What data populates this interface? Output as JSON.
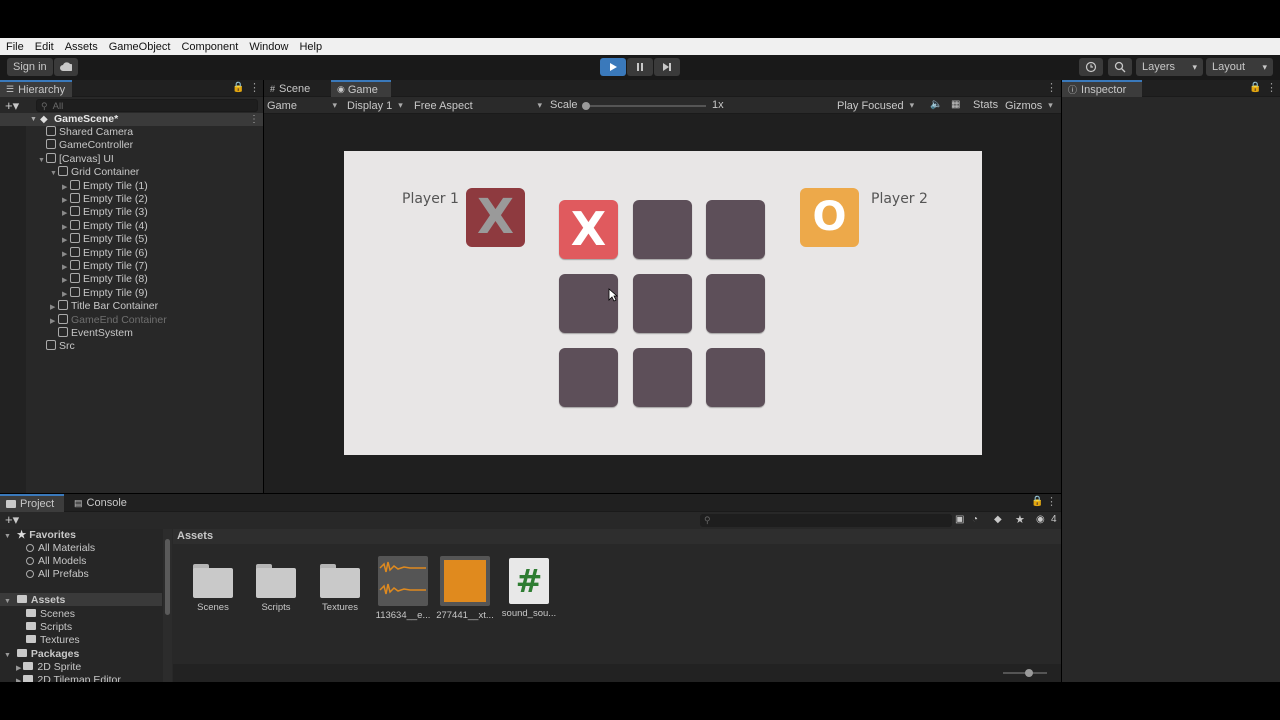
{
  "menu": [
    "File",
    "Edit",
    "Assets",
    "GameObject",
    "Component",
    "Window",
    "Help"
  ],
  "toolbar": {
    "sign_in": "Sign in",
    "layers": "Layers",
    "layout": "Layout"
  },
  "hierarchy": {
    "tab": "Hierarchy",
    "search_placeholder": "All",
    "scene": "GameScene*",
    "items": [
      {
        "label": "Shared Camera",
        "depth": 1
      },
      {
        "label": "GameController",
        "depth": 1
      },
      {
        "label": "[Canvas] UI",
        "depth": 1
      },
      {
        "label": "Grid Container",
        "depth": 2
      },
      {
        "label": "Empty Tile (1)",
        "depth": 3
      },
      {
        "label": "Empty Tile (2)",
        "depth": 3
      },
      {
        "label": "Empty Tile (3)",
        "depth": 3
      },
      {
        "label": "Empty Tile (4)",
        "depth": 3
      },
      {
        "label": "Empty Tile (5)",
        "depth": 3
      },
      {
        "label": "Empty Tile (6)",
        "depth": 3
      },
      {
        "label": "Empty Tile (7)",
        "depth": 3
      },
      {
        "label": "Empty Tile (8)",
        "depth": 3
      },
      {
        "label": "Empty Tile (9)",
        "depth": 3
      },
      {
        "label": "Title Bar Container",
        "depth": 2
      },
      {
        "label": "GameEnd Container",
        "depth": 2
      },
      {
        "label": "EventSystem",
        "depth": 2
      },
      {
        "label": "Src",
        "depth": 1
      }
    ]
  },
  "view_tabs": {
    "scene": "Scene",
    "game": "Game"
  },
  "game_bar": {
    "mode": "Game",
    "display": "Display 1",
    "aspect": "Free Aspect",
    "scale_label": "Scale",
    "scale_value": "1x",
    "play_focused": "Play Focused",
    "stats": "Stats",
    "gizmos": "Gizmos"
  },
  "game": {
    "player1": "Player 1",
    "player2": "Player 2",
    "p1_symbol": "X",
    "p2_symbol": "O",
    "board": [
      "X",
      "",
      "",
      "",
      "",
      "",
      "",
      "",
      ""
    ],
    "colors": {
      "canvas": "#e8e6e6",
      "tile": "#5d4f59",
      "x_tile": "#e05a5e",
      "p1_badge": "#8e3a3f",
      "p2_badge": "#eda94a"
    }
  },
  "inspector": {
    "tab": "Inspector"
  },
  "bottom_tabs": {
    "project": "Project",
    "console": "Console",
    "hidden_count": "4"
  },
  "project_tree": {
    "favorites": "Favorites",
    "favorite_items": [
      "All Materials",
      "All Models",
      "All Prefabs"
    ],
    "assets": "Assets",
    "asset_folders": [
      "Scenes",
      "Scripts",
      "Textures"
    ],
    "packages": "Packages",
    "package_items": [
      "2D Sprite",
      "2D Tilemap Editor"
    ]
  },
  "assets_panel": {
    "breadcrumb": "Assets",
    "items": [
      {
        "label": "Scenes",
        "kind": "folder"
      },
      {
        "label": "Scripts",
        "kind": "folder"
      },
      {
        "label": "Textures",
        "kind": "folder"
      },
      {
        "label": "113634__e...",
        "kind": "audio"
      },
      {
        "label": "277441__xt...",
        "kind": "audio-orange"
      },
      {
        "label": "sound_sou...",
        "kind": "script"
      }
    ]
  }
}
